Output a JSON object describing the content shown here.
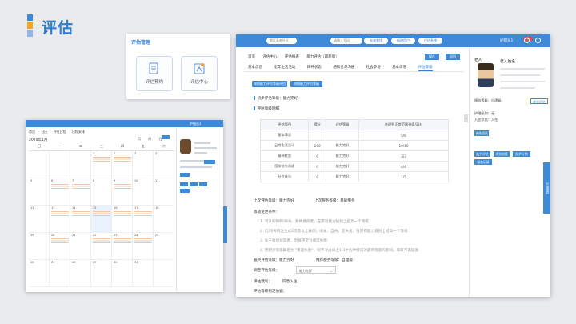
{
  "page": {
    "title": "评估",
    "accent": "#3f8ad8",
    "title_color": "#2e7fd6"
  },
  "mgmt": {
    "title": "评估管理",
    "btn1": "评估预约",
    "btn2": "评估中心"
  },
  "calendar": {
    "user": "护理员1",
    "tabs": [
      "首页",
      "日历",
      "评估日程",
      "日程安排"
    ],
    "month": "2020年1月",
    "views": [
      "月",
      "周",
      "日"
    ],
    "weekdays": [
      "日",
      "一",
      "二",
      "三",
      "四",
      "五",
      "六"
    ],
    "rows": [
      [
        "",
        "",
        "",
        "1",
        "2",
        "3",
        "4"
      ],
      [
        "5",
        "6",
        "7",
        "8",
        "9",
        "10",
        "11"
      ],
      [
        "12",
        "13",
        "14",
        "15",
        "16",
        "17",
        "18"
      ],
      [
        "19",
        "20",
        "21",
        "22",
        "23",
        "24",
        "25"
      ],
      [
        "26",
        "27",
        "28",
        "29",
        "30",
        "31",
        ""
      ]
    ]
  },
  "win": {
    "org_select": "都区养老社区",
    "search_placeholder": "请输入号码",
    "btn_search": "长者查找",
    "btn_add": "新增用户",
    "btn_eval": "评估系统",
    "user": "护理员1",
    "badge": "99+",
    "crumbs": [
      "首页",
      "评估中心",
      "评估报表",
      "能力评估（最新版）"
    ],
    "act1": "保存",
    "act2": "返回",
    "tabs": [
      "基本信息",
      "老年生活活动",
      "精神状态",
      "感知觉与沟通",
      "社会参与",
      "基本情况",
      "评估等级"
    ],
    "pill1": "按照能力评估等级评估",
    "pill2": "按照能力评估等级",
    "level_line": "初步评估等级：能力完好",
    "basis_title": "评估等级明细",
    "table_head": [
      "评估项目",
      "得分",
      "评估等级",
      "合理到正常范围分值/满分"
    ],
    "table_rows": [
      [
        "基本情况",
        "",
        "",
        "5/6"
      ],
      [
        "日常生活活动",
        "100",
        "能力完好",
        "10/10"
      ],
      [
        "精神状态",
        "0",
        "能力完好",
        "3/3"
      ],
      [
        "感知觉与沟通",
        "0",
        "能力完好",
        "4/4"
      ],
      [
        "社会参与",
        "0",
        "能力完好",
        "1/5"
      ]
    ],
    "last_level": "上次评估等级：能力完好",
    "last_service": "上次服务等级：基础服务",
    "change_title": "等级变更条件：",
    "conditions": [
      "1. 有认知障碍/痴呆、精神疾病者，在原有能力级别上提高一个等级",
      "2. 近30天内发生过2次及以上跌倒、噎食、自杀、走失者，在原有能力级别上提高一个等级",
      "3. 处于昏迷状态者，直接评定为重度失能",
      "4. 若初步等级确定为 \"重度失能\"，则不考虑以上1-3中各种情况对最终等级的影响，等级不再提高"
    ],
    "final_level": "最终评估等级：能力完好",
    "rec_service": "推荐服务等级：自理级",
    "adjust_label": "调整评估等级：",
    "adjust_value": "能力完好",
    "suggest_label": "评估建议：",
    "suggest_value": "同意入住",
    "basis_label": "评估等级判定依据：",
    "panel": {
      "tag": "老人",
      "name": "老人姓名",
      "care_level": "护理级别：",
      "care_value": "无",
      "status_label": "入住状态：",
      "status_value": "入住",
      "service_label": "服务等级：",
      "service_value": "自理级",
      "btn_eval": "能力评估",
      "btn_profile": "评估档案",
      "btn_plan": "照护计划",
      "btn_record": "服务记录",
      "vtab": "长者信息"
    }
  }
}
